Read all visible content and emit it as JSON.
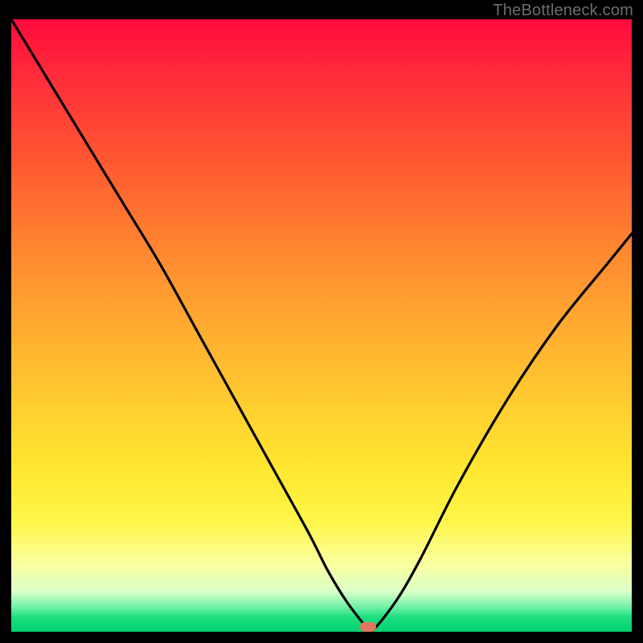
{
  "watermark": "TheBottleneck.com",
  "colors": {
    "background": "#000000",
    "curve": "#000000",
    "marker": "#e07860"
  },
  "chart_data": {
    "type": "line",
    "title": "",
    "xlabel": "",
    "ylabel": "",
    "xlim": [
      0,
      100
    ],
    "ylim": [
      0,
      100
    ],
    "grid": false,
    "series": [
      {
        "name": "bottleneck-curve",
        "x": [
          0,
          6,
          12,
          18,
          24,
          30,
          36,
          42,
          48,
          51,
          54,
          57,
          58,
          62,
          66,
          72,
          80,
          88,
          96,
          100
        ],
        "values": [
          100,
          90,
          80,
          70,
          60,
          49,
          38,
          27,
          16,
          10,
          5,
          1,
          0,
          5,
          12,
          24,
          38,
          50,
          60,
          65
        ]
      }
    ],
    "marker": {
      "x": 57.5,
      "y": 0.8
    },
    "background_gradient": [
      {
        "stop": 0.0,
        "color": "#ff0a3c"
      },
      {
        "stop": 0.1,
        "color": "#ff2f3a"
      },
      {
        "stop": 0.24,
        "color": "#ff5a30"
      },
      {
        "stop": 0.38,
        "color": "#ff8830"
      },
      {
        "stop": 0.52,
        "color": "#ffb030"
      },
      {
        "stop": 0.64,
        "color": "#ffd030"
      },
      {
        "stop": 0.74,
        "color": "#ffe830"
      },
      {
        "stop": 0.82,
        "color": "#fff64a"
      },
      {
        "stop": 0.89,
        "color": "#faffa0"
      },
      {
        "stop": 0.935,
        "color": "#d8ffc8"
      },
      {
        "stop": 0.96,
        "color": "#70f0a8"
      },
      {
        "stop": 0.975,
        "color": "#20e080"
      },
      {
        "stop": 1.0,
        "color": "#00d070"
      }
    ]
  }
}
